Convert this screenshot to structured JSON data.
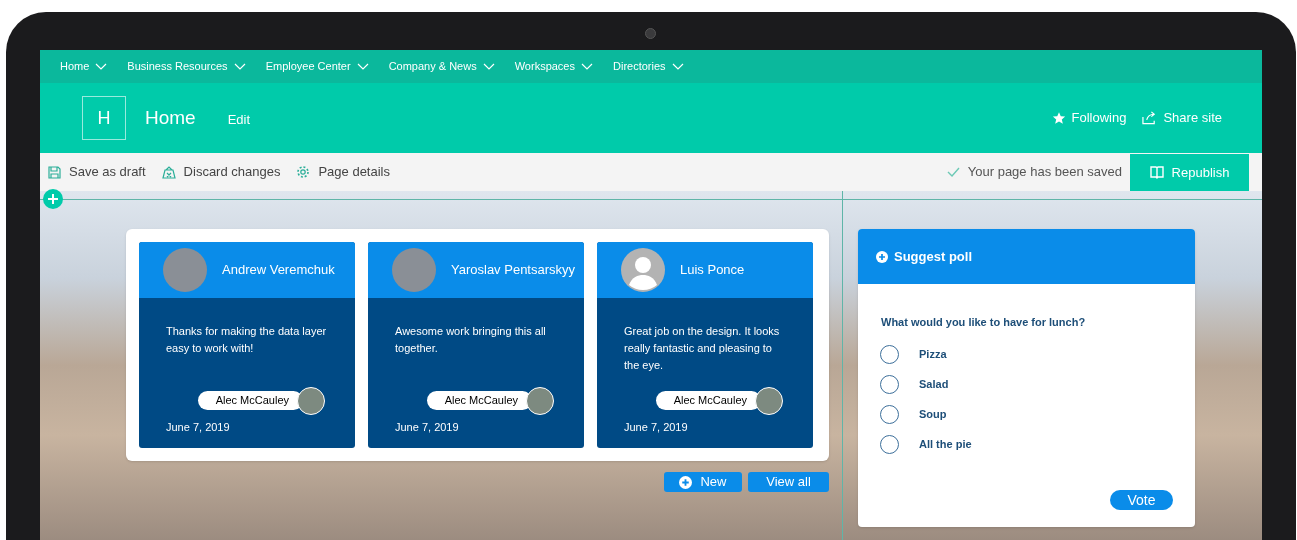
{
  "nav": [
    {
      "label": "Home"
    },
    {
      "label": "Business Resources"
    },
    {
      "label": "Employee Center"
    },
    {
      "label": "Company & News"
    },
    {
      "label": "Workspaces"
    },
    {
      "label": "Directories"
    }
  ],
  "site_header": {
    "logo_letter": "H",
    "title": "Home",
    "edit": "Edit",
    "following": "Following",
    "share": "Share site"
  },
  "command_bar": {
    "actions": [
      {
        "kind": "save",
        "label": "Save as draft"
      },
      {
        "kind": "discard",
        "label": "Discard changes"
      },
      {
        "kind": "details",
        "label": "Page details"
      }
    ],
    "status": "Your page has been saved",
    "republish": "Republish"
  },
  "kudos": [
    {
      "name": "Andrew Veremchuk",
      "kind": "photo",
      "message": "Thanks for making the data layer easy to work with!",
      "from": "Alec McCauley",
      "date": "June 7, 2019"
    },
    {
      "name": "Yaroslav Pentsarskyy",
      "kind": "photo",
      "message": "Awesome work bringing this all together.",
      "from": "Alec McCauley",
      "date": "June 7, 2019"
    },
    {
      "name": "Luis Ponce",
      "kind": "silhouette",
      "message": "Great job on the design. It looks really fantastic and pleasing to the eye.",
      "from": "Alec McCauley",
      "date": "June 7, 2019"
    }
  ],
  "kudos_buttons": {
    "new": "New",
    "view_all": "View all"
  },
  "poll": {
    "header": "Suggest poll",
    "question": "What would you like to have for lunch?",
    "options": [
      {
        "label": "Pizza",
        "selected": false
      },
      {
        "label": "Salad",
        "selected": false
      },
      {
        "label": "Soup",
        "selected": false
      },
      {
        "label": "All the pie",
        "selected": false
      }
    ],
    "vote": "Vote"
  }
}
